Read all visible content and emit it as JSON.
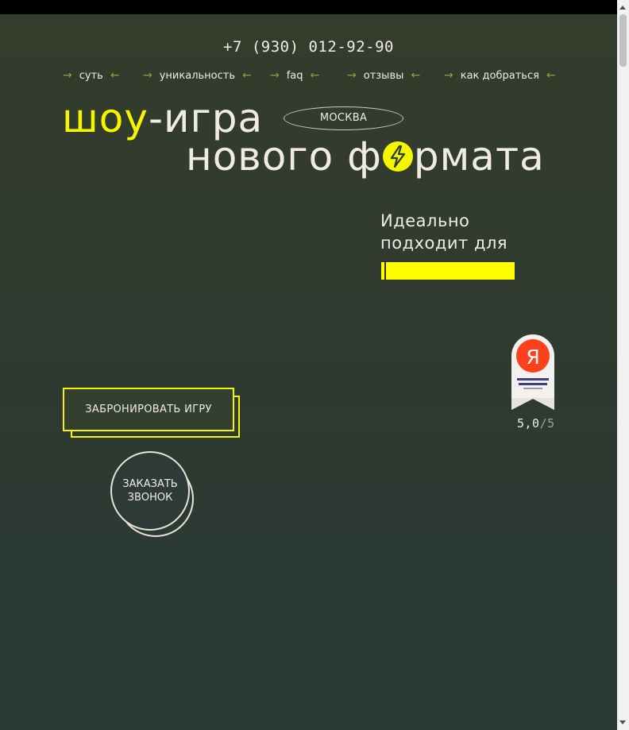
{
  "header": {
    "phone": "+7 (930) 012-92-90"
  },
  "nav": {
    "items": [
      {
        "label": "суть"
      },
      {
        "label": "уникальность"
      },
      {
        "label": "faq"
      },
      {
        "label": "отзывы"
      },
      {
        "label": "как добраться"
      }
    ],
    "arrow_right": "→",
    "arrow_left": "←"
  },
  "hero": {
    "title_highlight": "шоу",
    "title_rest": "-игра",
    "title_line2_a": "нового ф",
    "title_line2_b": "рмата",
    "city": "МОСКВА",
    "ideal_line1": "Идеально",
    "ideal_line2": "подходит для",
    "book_button": "ЗАБРОНИРОВАТЬ ИГРУ",
    "call_button_line1": "ЗАКАЗАТЬ",
    "call_button_line2": "ЗВОНОК"
  },
  "rating": {
    "value": "5,0",
    "separator": "/",
    "max": "5",
    "badge_logo": "Я"
  },
  "colors": {
    "accent": "#f5f500",
    "nav_arrow": "#7ea83c",
    "text": "#f0ebe3",
    "background_top": "#343c2b",
    "background_bottom": "#283b37",
    "badge_red": "#fc3f1d"
  }
}
